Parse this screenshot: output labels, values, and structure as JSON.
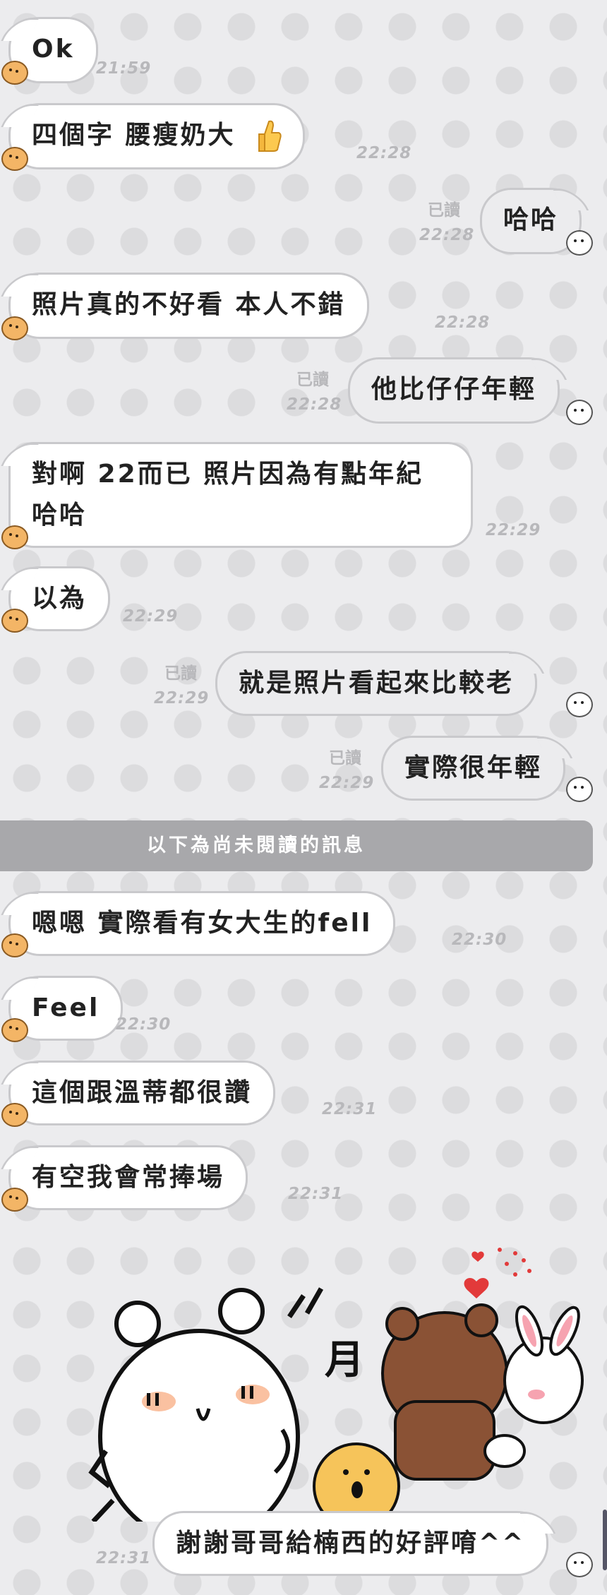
{
  "messages": [
    {
      "id": "m1",
      "side": "in",
      "text": "Ok",
      "time": "21:59"
    },
    {
      "id": "m2",
      "side": "in",
      "text": "四個字  腰瘦奶大",
      "emoji": "thumbs-up",
      "time": "22:28"
    },
    {
      "id": "m3",
      "side": "out",
      "text": "哈哈",
      "read": "已讀",
      "time": "22:28"
    },
    {
      "id": "m4",
      "side": "in",
      "text": "照片真的不好看  本人不錯",
      "time": "22:28"
    },
    {
      "id": "m5",
      "side": "out",
      "text": "他比仔仔年輕",
      "read": "已讀",
      "time": "22:28"
    },
    {
      "id": "m6",
      "side": "in",
      "text": "對啊 22而已  照片因為有點年紀哈哈",
      "time": "22:29"
    },
    {
      "id": "m7",
      "side": "in",
      "text": "以為",
      "time": "22:29"
    },
    {
      "id": "m8",
      "side": "out",
      "text": "就是照片看起來比較老",
      "read": "已讀",
      "time": "22:29"
    },
    {
      "id": "m9",
      "side": "out",
      "text": "實際很年輕",
      "read": "已讀",
      "time": "22:29"
    },
    {
      "id": "m10",
      "side": "in",
      "text": "嗯嗯  實際看有女大生的fell",
      "time": "22:30"
    },
    {
      "id": "m11",
      "side": "in",
      "text": "Feel",
      "time": "22:30"
    },
    {
      "id": "m12",
      "side": "in",
      "text": "這個跟溫蒂都很讚",
      "time": "22:31"
    },
    {
      "id": "m13",
      "side": "in",
      "text": "有空我會常捧場",
      "time": "22:31"
    },
    {
      "id": "m14",
      "side": "in",
      "sticker": "bear-and-bunny-sticker",
      "time": "22:31"
    },
    {
      "id": "m15",
      "side": "out",
      "text": "謝謝哥哥給楠西的好評唷^^",
      "time": "22:31"
    }
  ],
  "divider": {
    "text": "以下為尚未閱讀的訊息"
  },
  "sticker_text": "月",
  "colors": {
    "bubble_in": "#ffffff",
    "bubble_out": "#ececee",
    "border": "#c9c9cc",
    "divider": "#a8a8ab",
    "time": "#b8b8bb"
  }
}
